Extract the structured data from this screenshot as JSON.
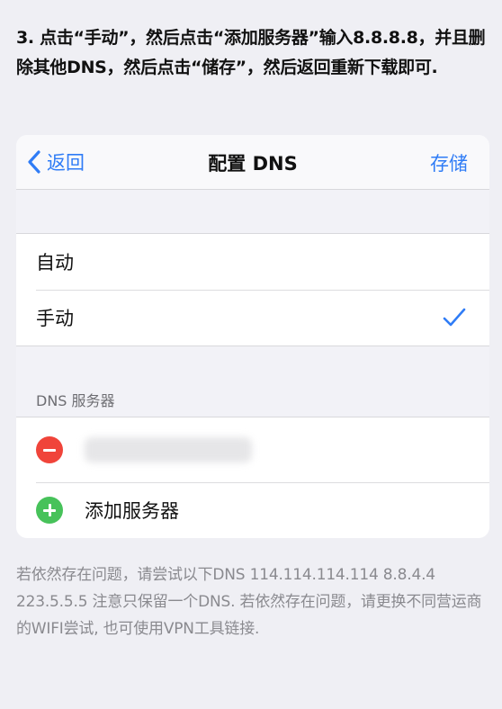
{
  "instructions": {
    "text": "3. 点击“手动”，然后点击“添加服务器”输入8.8.8.8，并且删除其他DNS，然后点击“储存”，然后返回重新下载即可."
  },
  "navbar": {
    "back_label": "返回",
    "title": "配置 DNS",
    "save_label": "存储",
    "accent_color": "#2f7cf6"
  },
  "mode_options": {
    "items": [
      {
        "label": "自动",
        "selected": false
      },
      {
        "label": "手动",
        "selected": true
      }
    ],
    "check_icon": "checkmark-icon"
  },
  "dns_servers": {
    "header": "DNS 服务器",
    "remove_icon": "remove-circle-icon",
    "remove_color": "#f0443a",
    "add_icon": "add-circle-icon",
    "add_color": "#47c25a",
    "add_label": "添加服务器"
  },
  "note": {
    "text": "若依然存在问题，请尝试以下DNS 114.114.114.114 8.8.4.4  223.5.5.5 注意只保留一个DNS. 若依然存在问题，请更换不同营运商的WIFI尝试, 也可使用VPN工具链接."
  }
}
